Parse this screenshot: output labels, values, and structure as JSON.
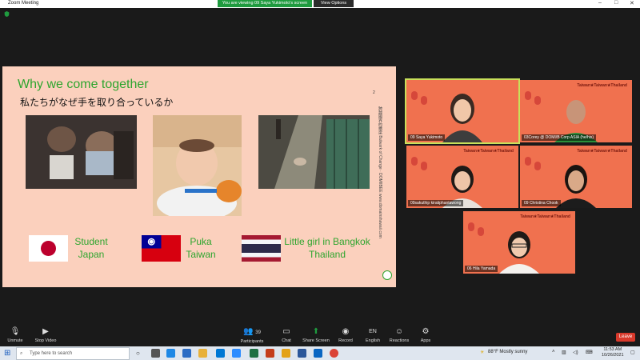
{
  "window": {
    "title": "Zoom Meeting",
    "share_banner": "You are viewing 09 Saya Yukimoto's screen",
    "view_options": "View Options",
    "controls": [
      "–",
      "□",
      "✕"
    ]
  },
  "slide": {
    "title": "Why we come together",
    "subtitle": "私たちがなぜ手を取り合っているか",
    "page_number": "2",
    "side_text": "跨越國界的橋梁 Bulwark of Change · DOMIIBEE www.domainshawaii.com",
    "items": [
      {
        "caption_line1": "Student",
        "caption_line2": "Japan",
        "flag": "japan-flag"
      },
      {
        "caption_line1": "Puka",
        "caption_line2": "Taiwan",
        "flag": "taiwan-flag"
      },
      {
        "caption_line1": "Little girl in Bangkok",
        "caption_line2": "Thailand",
        "flag": "thailand-flag"
      }
    ]
  },
  "participants": [
    {
      "name": "09 Saya Yukimoto"
    },
    {
      "name": "03Corey @ DOMI/B Corp ASIA (he/his)"
    },
    {
      "name": "09sakuthip kiratiphantawong"
    },
    {
      "name": "09 Christina Chook"
    },
    {
      "name": "06 Hila Yamada"
    }
  ],
  "tile_banner": "Taiwan★Taiwan★Thailand",
  "toolbar": {
    "unmute": "Unmute",
    "stop_video": "Stop Video",
    "participants": "Participants",
    "participants_count": "39",
    "chat": "Chat",
    "share_screen": "Share Screen",
    "record": "Record",
    "english": "English",
    "english_badge": "EN",
    "reactions": "Reactions",
    "apps": "Apps",
    "leave": "Leave"
  },
  "taskbar": {
    "search_placeholder": "Type here to search",
    "weather": "88°F  Mostly sunny",
    "time": "11:53 AM",
    "date": "10/26/2021"
  },
  "colors": {
    "slide_bg": "#fbd0bd",
    "accent_green": "#2ea52e",
    "tile_bg": "#f0714f",
    "leave_red": "#d8392b"
  }
}
